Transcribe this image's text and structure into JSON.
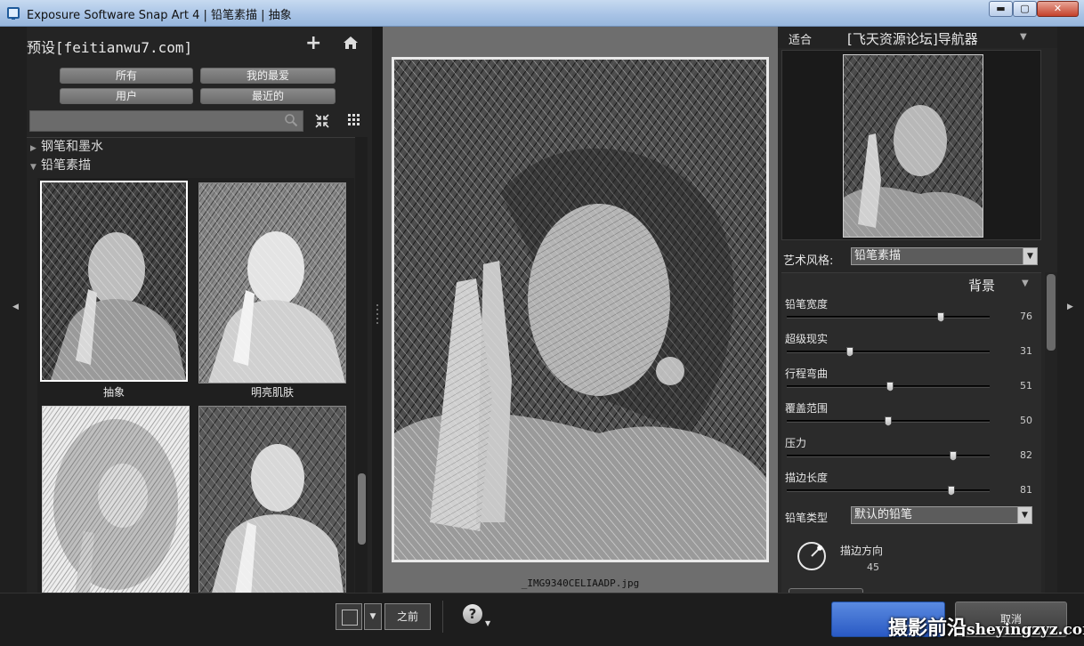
{
  "window": {
    "title": "Exposure Software Snap Art 4 | 铅笔素描 | 抽象",
    "minimize_label": "▬",
    "maximize_label": "▢",
    "close_label": "✕"
  },
  "presets": {
    "title": "预设[feitianwu7.com]",
    "add_label": "+",
    "filters": [
      "所有",
      "我的最爱",
      "用户",
      "最近的"
    ],
    "search_placeholder": "",
    "categories": [
      {
        "label": "钢笔和墨水",
        "expanded": false
      },
      {
        "label": "铅笔素描",
        "expanded": true
      }
    ],
    "thumbnails": [
      {
        "label": "抽象",
        "selected": true
      },
      {
        "label": "明亮肌肤",
        "selected": false
      },
      {
        "label": "",
        "selected": false
      },
      {
        "label": "",
        "selected": false
      }
    ]
  },
  "canvas": {
    "filename": "_IMG9340CELIAADP.jpg"
  },
  "navigator": {
    "fit_label": "适合",
    "title": "[飞天资源论坛]导航器"
  },
  "settings": {
    "art_style_label": "艺术风格:",
    "art_style_value": "铅笔素描",
    "section_title": "背景",
    "sliders": [
      {
        "label": "铅笔宽度",
        "value": 76,
        "max": 100
      },
      {
        "label": "超级现实",
        "value": 31,
        "max": 100
      },
      {
        "label": "行程弯曲",
        "value": 51,
        "max": 100
      },
      {
        "label": "覆盖范围",
        "value": 50,
        "max": 100
      },
      {
        "label": "压力",
        "value": 82,
        "max": 100
      },
      {
        "label": "描边长度",
        "value": 81,
        "max": 100
      }
    ],
    "pencil_type_label": "铅笔类型",
    "pencil_type_value": "默认的铅笔",
    "stroke_direction_label": "描边方向",
    "stroke_direction_value": 45
  },
  "bottom_bar": {
    "before_label": "之前",
    "help_label": "?",
    "ok_label": "",
    "cancel_label": "取消"
  },
  "watermark": {
    "cn": "摄影前沿",
    "domain": "sheyingzyz.com"
  },
  "colors": {
    "accent_ok": "#3a6fd4",
    "panel_bg": "#242424"
  }
}
